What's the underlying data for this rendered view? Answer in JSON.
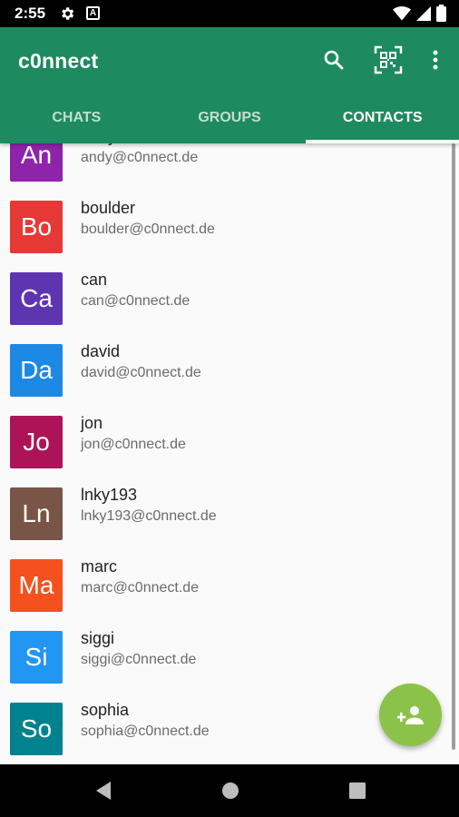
{
  "status": {
    "time": "2:55",
    "a_label": "A"
  },
  "appbar": {
    "title": "c0nnect"
  },
  "tabs": [
    {
      "label": "CHATS"
    },
    {
      "label": "GROUPS"
    },
    {
      "label": "CONTACTS"
    }
  ],
  "contacts": [
    {
      "initials": "An",
      "name": "andy",
      "email": "andy@c0nnect.de",
      "color": "#8e24aa"
    },
    {
      "initials": "Bo",
      "name": "boulder",
      "email": "boulder@c0nnect.de",
      "color": "#e53935"
    },
    {
      "initials": "Ca",
      "name": "can",
      "email": "can@c0nnect.de",
      "color": "#5e35b1"
    },
    {
      "initials": "Da",
      "name": "david",
      "email": "david@c0nnect.de",
      "color": "#1e88e5"
    },
    {
      "initials": "Jo",
      "name": "jon",
      "email": "jon@c0nnect.de",
      "color": "#ad1457"
    },
    {
      "initials": "Ln",
      "name": "lnky193",
      "email": "lnky193@c0nnect.de",
      "color": "#795548"
    },
    {
      "initials": "Ma",
      "name": "marc",
      "email": "marc@c0nnect.de",
      "color": "#f4511e"
    },
    {
      "initials": "Si",
      "name": "siggi",
      "email": "siggi@c0nnect.de",
      "color": "#2196f3"
    },
    {
      "initials": "So",
      "name": "sophia",
      "email": "sophia@c0nnect.de",
      "color": "#00838f"
    }
  ],
  "icons": {
    "search": "search-icon",
    "qr": "qr-code-icon",
    "more": "more-vert-icon",
    "fab": "add-contact-icon"
  },
  "colors": {
    "primary": "#1e8a5f",
    "fab": "#8bc34a"
  }
}
